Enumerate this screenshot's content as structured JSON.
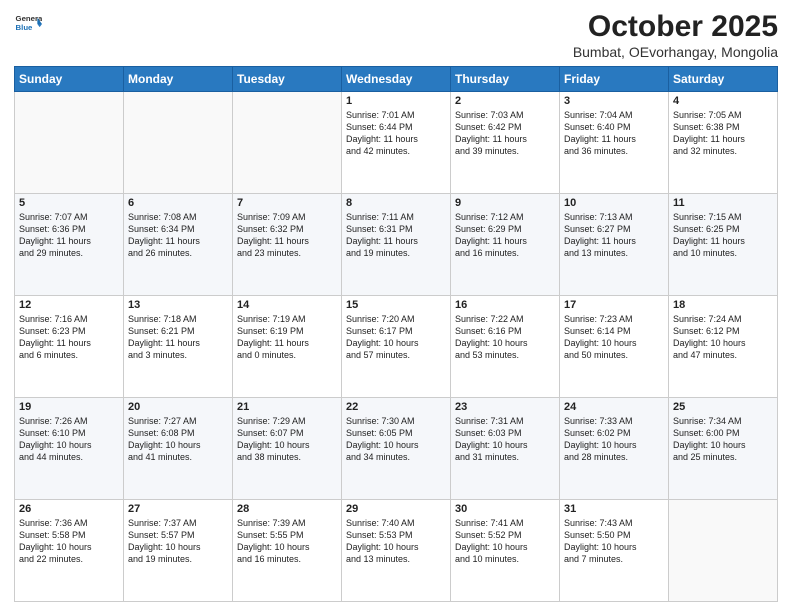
{
  "header": {
    "logo_general": "General",
    "logo_blue": "Blue",
    "title": "October 2025",
    "subtitle": "Bumbat, OEvorhangay, Mongolia"
  },
  "days_of_week": [
    "Sunday",
    "Monday",
    "Tuesday",
    "Wednesday",
    "Thursday",
    "Friday",
    "Saturday"
  ],
  "weeks": [
    [
      {
        "day": "",
        "info": ""
      },
      {
        "day": "",
        "info": ""
      },
      {
        "day": "",
        "info": ""
      },
      {
        "day": "1",
        "info": "Sunrise: 7:01 AM\nSunset: 6:44 PM\nDaylight: 11 hours\nand 42 minutes."
      },
      {
        "day": "2",
        "info": "Sunrise: 7:03 AM\nSunset: 6:42 PM\nDaylight: 11 hours\nand 39 minutes."
      },
      {
        "day": "3",
        "info": "Sunrise: 7:04 AM\nSunset: 6:40 PM\nDaylight: 11 hours\nand 36 minutes."
      },
      {
        "day": "4",
        "info": "Sunrise: 7:05 AM\nSunset: 6:38 PM\nDaylight: 11 hours\nand 32 minutes."
      }
    ],
    [
      {
        "day": "5",
        "info": "Sunrise: 7:07 AM\nSunset: 6:36 PM\nDaylight: 11 hours\nand 29 minutes."
      },
      {
        "day": "6",
        "info": "Sunrise: 7:08 AM\nSunset: 6:34 PM\nDaylight: 11 hours\nand 26 minutes."
      },
      {
        "day": "7",
        "info": "Sunrise: 7:09 AM\nSunset: 6:32 PM\nDaylight: 11 hours\nand 23 minutes."
      },
      {
        "day": "8",
        "info": "Sunrise: 7:11 AM\nSunset: 6:31 PM\nDaylight: 11 hours\nand 19 minutes."
      },
      {
        "day": "9",
        "info": "Sunrise: 7:12 AM\nSunset: 6:29 PM\nDaylight: 11 hours\nand 16 minutes."
      },
      {
        "day": "10",
        "info": "Sunrise: 7:13 AM\nSunset: 6:27 PM\nDaylight: 11 hours\nand 13 minutes."
      },
      {
        "day": "11",
        "info": "Sunrise: 7:15 AM\nSunset: 6:25 PM\nDaylight: 11 hours\nand 10 minutes."
      }
    ],
    [
      {
        "day": "12",
        "info": "Sunrise: 7:16 AM\nSunset: 6:23 PM\nDaylight: 11 hours\nand 6 minutes."
      },
      {
        "day": "13",
        "info": "Sunrise: 7:18 AM\nSunset: 6:21 PM\nDaylight: 11 hours\nand 3 minutes."
      },
      {
        "day": "14",
        "info": "Sunrise: 7:19 AM\nSunset: 6:19 PM\nDaylight: 11 hours\nand 0 minutes."
      },
      {
        "day": "15",
        "info": "Sunrise: 7:20 AM\nSunset: 6:17 PM\nDaylight: 10 hours\nand 57 minutes."
      },
      {
        "day": "16",
        "info": "Sunrise: 7:22 AM\nSunset: 6:16 PM\nDaylight: 10 hours\nand 53 minutes."
      },
      {
        "day": "17",
        "info": "Sunrise: 7:23 AM\nSunset: 6:14 PM\nDaylight: 10 hours\nand 50 minutes."
      },
      {
        "day": "18",
        "info": "Sunrise: 7:24 AM\nSunset: 6:12 PM\nDaylight: 10 hours\nand 47 minutes."
      }
    ],
    [
      {
        "day": "19",
        "info": "Sunrise: 7:26 AM\nSunset: 6:10 PM\nDaylight: 10 hours\nand 44 minutes."
      },
      {
        "day": "20",
        "info": "Sunrise: 7:27 AM\nSunset: 6:08 PM\nDaylight: 10 hours\nand 41 minutes."
      },
      {
        "day": "21",
        "info": "Sunrise: 7:29 AM\nSunset: 6:07 PM\nDaylight: 10 hours\nand 38 minutes."
      },
      {
        "day": "22",
        "info": "Sunrise: 7:30 AM\nSunset: 6:05 PM\nDaylight: 10 hours\nand 34 minutes."
      },
      {
        "day": "23",
        "info": "Sunrise: 7:31 AM\nSunset: 6:03 PM\nDaylight: 10 hours\nand 31 minutes."
      },
      {
        "day": "24",
        "info": "Sunrise: 7:33 AM\nSunset: 6:02 PM\nDaylight: 10 hours\nand 28 minutes."
      },
      {
        "day": "25",
        "info": "Sunrise: 7:34 AM\nSunset: 6:00 PM\nDaylight: 10 hours\nand 25 minutes."
      }
    ],
    [
      {
        "day": "26",
        "info": "Sunrise: 7:36 AM\nSunset: 5:58 PM\nDaylight: 10 hours\nand 22 minutes."
      },
      {
        "day": "27",
        "info": "Sunrise: 7:37 AM\nSunset: 5:57 PM\nDaylight: 10 hours\nand 19 minutes."
      },
      {
        "day": "28",
        "info": "Sunrise: 7:39 AM\nSunset: 5:55 PM\nDaylight: 10 hours\nand 16 minutes."
      },
      {
        "day": "29",
        "info": "Sunrise: 7:40 AM\nSunset: 5:53 PM\nDaylight: 10 hours\nand 13 minutes."
      },
      {
        "day": "30",
        "info": "Sunrise: 7:41 AM\nSunset: 5:52 PM\nDaylight: 10 hours\nand 10 minutes."
      },
      {
        "day": "31",
        "info": "Sunrise: 7:43 AM\nSunset: 5:50 PM\nDaylight: 10 hours\nand 7 minutes."
      },
      {
        "day": "",
        "info": ""
      }
    ]
  ]
}
